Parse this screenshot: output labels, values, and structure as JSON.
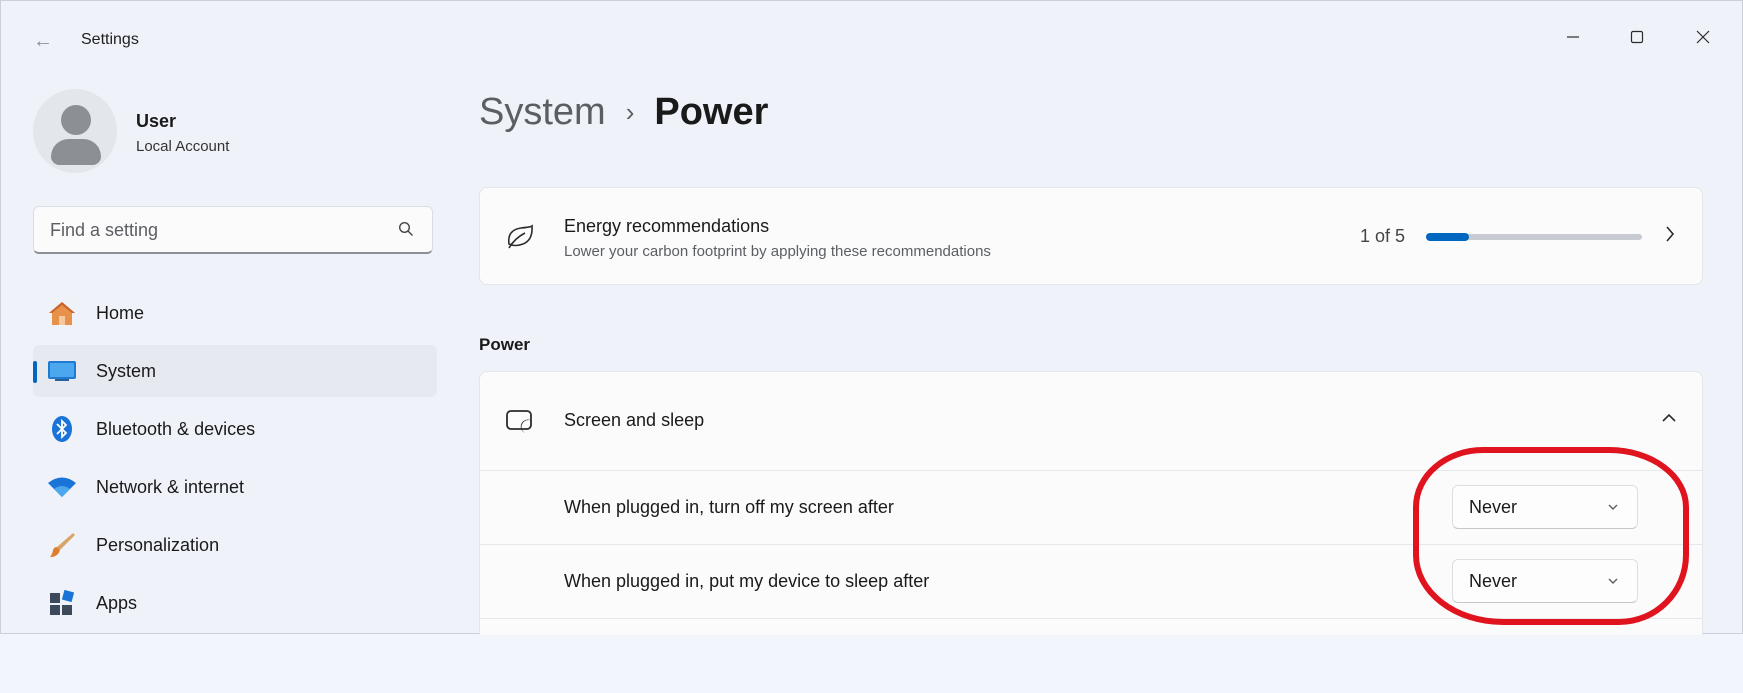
{
  "window": {
    "title": "Settings",
    "controls": {
      "minimize": "minimize-icon",
      "maximize": "maximize-icon",
      "close": "close-icon"
    }
  },
  "user": {
    "name": "User",
    "account_type": "Local Account"
  },
  "search": {
    "placeholder": "Find a setting"
  },
  "sidebar": {
    "items": [
      {
        "label": "Home",
        "icon": "home-icon"
      },
      {
        "label": "System",
        "icon": "system-icon",
        "selected": true
      },
      {
        "label": "Bluetooth & devices",
        "icon": "bluetooth-icon"
      },
      {
        "label": "Network & internet",
        "icon": "wifi-icon"
      },
      {
        "label": "Personalization",
        "icon": "brush-icon"
      },
      {
        "label": "Apps",
        "icon": "apps-icon"
      }
    ]
  },
  "breadcrumb": {
    "parent": "System",
    "separator": "›",
    "current": "Power"
  },
  "energy": {
    "title": "Energy recommendations",
    "subtitle": "Lower your carbon footprint by applying these recommendations",
    "progress_text": "1 of 5",
    "progress_fraction": 0.2
  },
  "power_section": {
    "heading": "Power",
    "screen_sleep": {
      "title": "Screen and sleep",
      "expanded": true,
      "rows": [
        {
          "label": "When plugged in, turn off my screen after",
          "value": "Never"
        },
        {
          "label": "When plugged in, put my device to sleep after",
          "value": "Never"
        }
      ]
    }
  },
  "colors": {
    "accent": "#0067c0",
    "highlight": "#e0141e",
    "background": "#eff3f9",
    "card": "#fbfbfc"
  }
}
